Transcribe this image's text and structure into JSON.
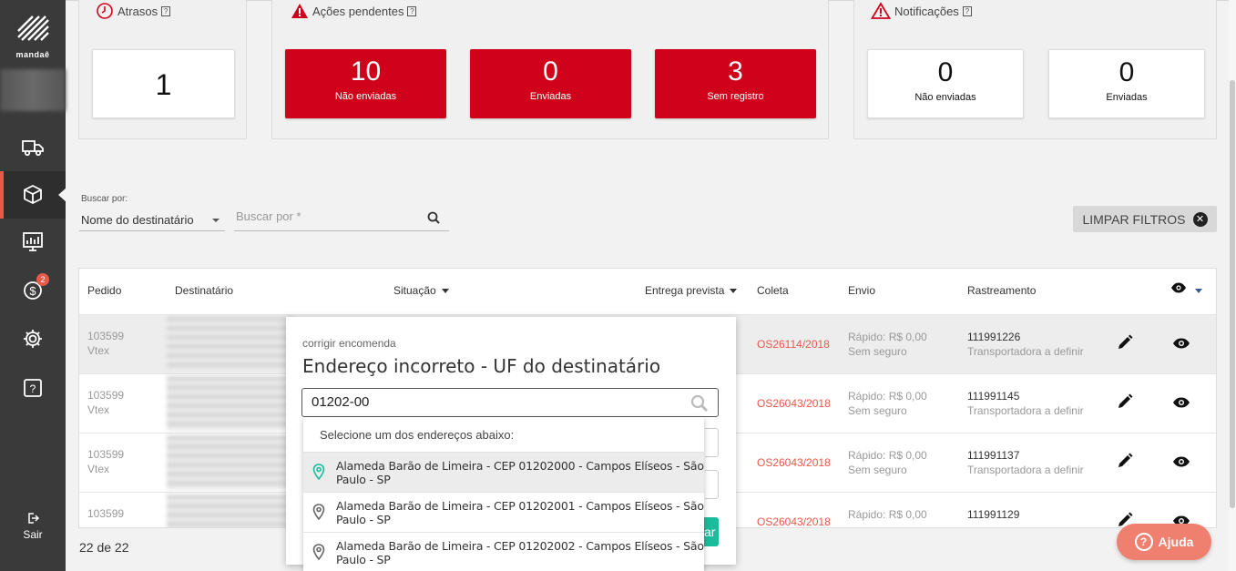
{
  "brand": {
    "logo_text": "mandaê"
  },
  "sidebar": {
    "items": [
      {
        "name": "truck-icon"
      },
      {
        "name": "package-icon",
        "active": true
      },
      {
        "name": "dashboard-icon"
      },
      {
        "name": "dollar-icon",
        "badge": "2"
      },
      {
        "name": "gear-icon"
      },
      {
        "name": "help-icon"
      }
    ],
    "logout_label": "Sair"
  },
  "cards": {
    "delays": {
      "title": "Atrasos",
      "help": "?",
      "value": "1"
    },
    "pending": {
      "title": "Ações pendentes",
      "help": "?",
      "stats": [
        {
          "value": "10",
          "label": "Não enviadas"
        },
        {
          "value": "0",
          "label": "Enviadas"
        },
        {
          "value": "3",
          "label": "Sem registro"
        }
      ]
    },
    "notifications": {
      "title": "Notificações",
      "help": "?",
      "stats": [
        {
          "value": "0",
          "label": "Não enviadas"
        },
        {
          "value": "0",
          "label": "Enviadas"
        }
      ]
    }
  },
  "search": {
    "search_by_label": "Buscar por:",
    "search_by_value": "Nome do destinatário",
    "input_placeholder": "Buscar por *",
    "clear_filters_label": "LIMPAR FILTROS"
  },
  "table": {
    "headers": {
      "order": "Pedido",
      "recipient": "Destinatário",
      "status": "Situação",
      "expected": "Entrega prevista",
      "pickup": "Coleta",
      "shipping": "Envio",
      "tracking": "Rastreamento"
    },
    "rows": [
      {
        "order_id": "103599",
        "store": "Vtex",
        "pickup": "OS26114/2018",
        "shipping": "Rápido: R$ 0,00",
        "insurance": "Sem seguro",
        "tracking": "111991226",
        "carrier": "Transportadora a definir"
      },
      {
        "order_id": "103599",
        "store": "Vtex",
        "pickup": "OS26043/2018",
        "shipping": "Rápido: R$ 0,00",
        "insurance": "Sem seguro",
        "tracking": "111991145",
        "carrier": "Transportadora a definir"
      },
      {
        "order_id": "103599",
        "store": "Vtex",
        "pickup": "OS26043/2018",
        "shipping": "Rápido: R$ 0,00",
        "insurance": "Sem seguro",
        "tracking": "111991137",
        "carrier": "Transportadora a definir"
      },
      {
        "order_id": "103599",
        "store": "",
        "pickup": "OS26043/2018",
        "shipping": "Rápido: R$ 0,00",
        "insurance": "",
        "tracking": "111991129",
        "carrier": ""
      }
    ],
    "count": "22 de 22"
  },
  "popup": {
    "subtitle": "corrigir encomenda",
    "title": "Endereço incorreto - UF do destinatário",
    "input_value": "01202-00",
    "button_fragment": "ar",
    "dropdown": {
      "header": "Selecione um dos endereços abaixo:",
      "items": [
        "Alameda Barão de Limeira - CEP 01202000 - Campos Elíseos - São Paulo - SP",
        "Alameda Barão de Limeira - CEP 01202001 - Campos Elíseos - São Paulo - SP",
        "Alameda Barão de Limeira - CEP 01202002 - Campos Elíseos - São Paulo - SP"
      ]
    }
  },
  "help_button": {
    "label": "Ajuda"
  },
  "colors": {
    "red": "#d0021b",
    "accent": "#e8594a",
    "sidebar": "#3a3a3a",
    "pin_green": "#1abc9c"
  }
}
